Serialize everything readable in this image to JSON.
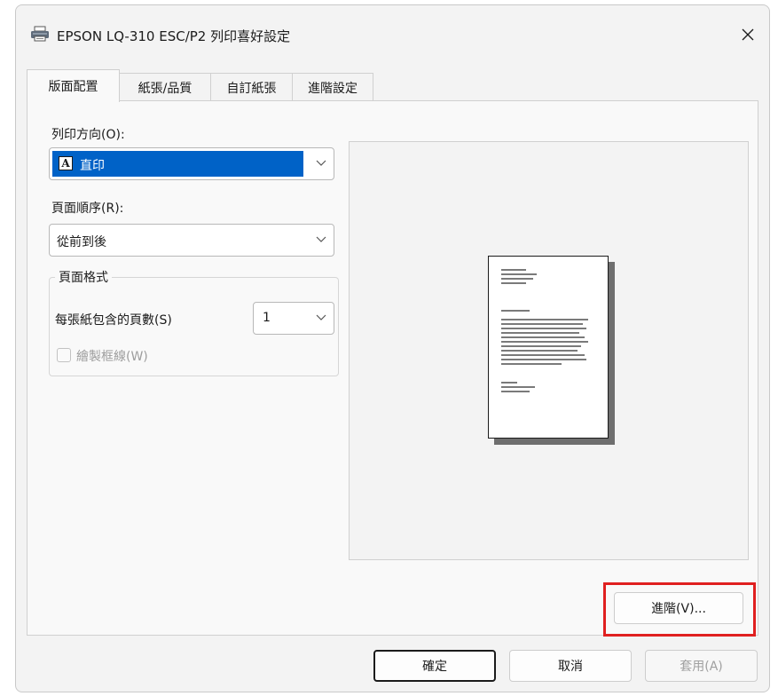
{
  "window": {
    "title": "EPSON LQ-310 ESC/P2 列印喜好設定",
    "icons": {
      "app": "printer-icon",
      "close": "close-icon"
    }
  },
  "tabs": [
    {
      "label": "版面配置",
      "active": true
    },
    {
      "label": "紙張/品質",
      "active": false
    },
    {
      "label": "自訂紙張",
      "active": false
    },
    {
      "label": "進階設定",
      "active": false
    }
  ],
  "layout": {
    "orientation": {
      "label": "列印方向(O):",
      "value": "直印",
      "icon_letter": "A"
    },
    "page_order": {
      "label": "頁面順序(R):",
      "value": "從前到後"
    },
    "page_format": {
      "group_title": "頁面格式",
      "pages_per_sheet_label": "每張紙包含的頁數(S)",
      "pages_per_sheet_value": "1",
      "draw_borders_label": "繪製框線(W)",
      "draw_borders_checked": false
    },
    "advanced_button": "進階(V)..."
  },
  "footer": {
    "ok": "確定",
    "cancel": "取消",
    "apply": "套用(A)"
  },
  "colors": {
    "selection": "#0062c7",
    "annotation_box": "#e02020"
  }
}
